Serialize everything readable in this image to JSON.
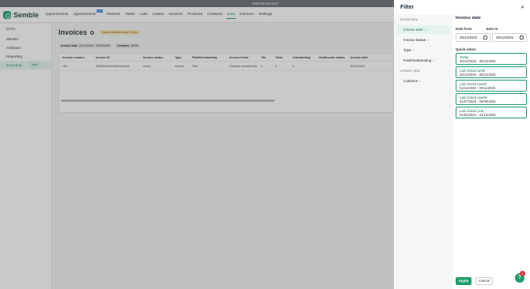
{
  "topbar": {
    "text": "Internal account"
  },
  "brand": {
    "name": "Semble"
  },
  "nav": {
    "items": [
      "Appointments",
      "Appointments",
      "Patients",
      "Tasks",
      "Labs",
      "Letters",
      "Invoices",
      "Products",
      "Contacts",
      "Data",
      "Connect",
      "Settings"
    ],
    "badge": "New",
    "active": "Data"
  },
  "sidebar": {
    "items": [
      "DATA",
      "Monitor",
      "Analytics",
      "Reporting",
      "Exporting"
    ],
    "new_badge": "New"
  },
  "main": {
    "title": "Invoices",
    "refresh": "Data refreshes every 15 min",
    "chips": [
      {
        "label": "Invoice date",
        "value": "30/12/2025 - 30/12/2025"
      },
      {
        "label": "Columns",
        "value": "20/28"
      }
    ],
    "columns": [
      "Invoice number",
      "Invoice ID",
      "Invoice status",
      "Type",
      "Paid/Outstanding",
      "Invoice items",
      "Tax",
      "Total",
      "Outstanding",
      "Healthcode status",
      "Invoice date"
    ],
    "rows": [
      [
        "100",
        "6951f30f0cd0a0fe1fef1bde",
        "Active",
        "Invoice",
        "Paid",
        "Example membership",
        "0",
        "0",
        "0",
        "",
        "30/12/2025"
      ]
    ]
  },
  "filter": {
    "title": "Filter",
    "filter_data_label": "FILTER DATA",
    "filter_items": [
      "Invoice date",
      "Invoice status",
      "Type",
      "Paid/Outstanding"
    ],
    "update_view_label": "UPDATE VIEW",
    "update_items": [
      "Columns"
    ],
    "detail": {
      "title": "Invoice date",
      "date_from_label": "Date from",
      "date_to_label": "Date to",
      "date_from": "30/12/2025",
      "date_to": "30/12/2025",
      "quick_select_label": "Quick select",
      "quick": [
        {
          "title": "Today",
          "range": "30/12/2025 - 30/12/2025"
        },
        {
          "title": "Last closed week",
          "range": "22/12/2025 - 28/12/2025"
        },
        {
          "title": "Last closed month",
          "range": "01/11/2025 - 30/11/2025"
        },
        {
          "title": "Last closed quarter",
          "range": "01/07/2025 - 30/09/2025"
        },
        {
          "title": "Last closed year",
          "range": "01/01/2024 - 31/12/2024"
        }
      ]
    },
    "apply_label": "Apply",
    "cancel_label": "Cancel"
  },
  "help": {
    "icon": "?",
    "badge": "1"
  },
  "colors": {
    "accent": "#1d9e6b",
    "overlay": "#3c3c3c"
  }
}
